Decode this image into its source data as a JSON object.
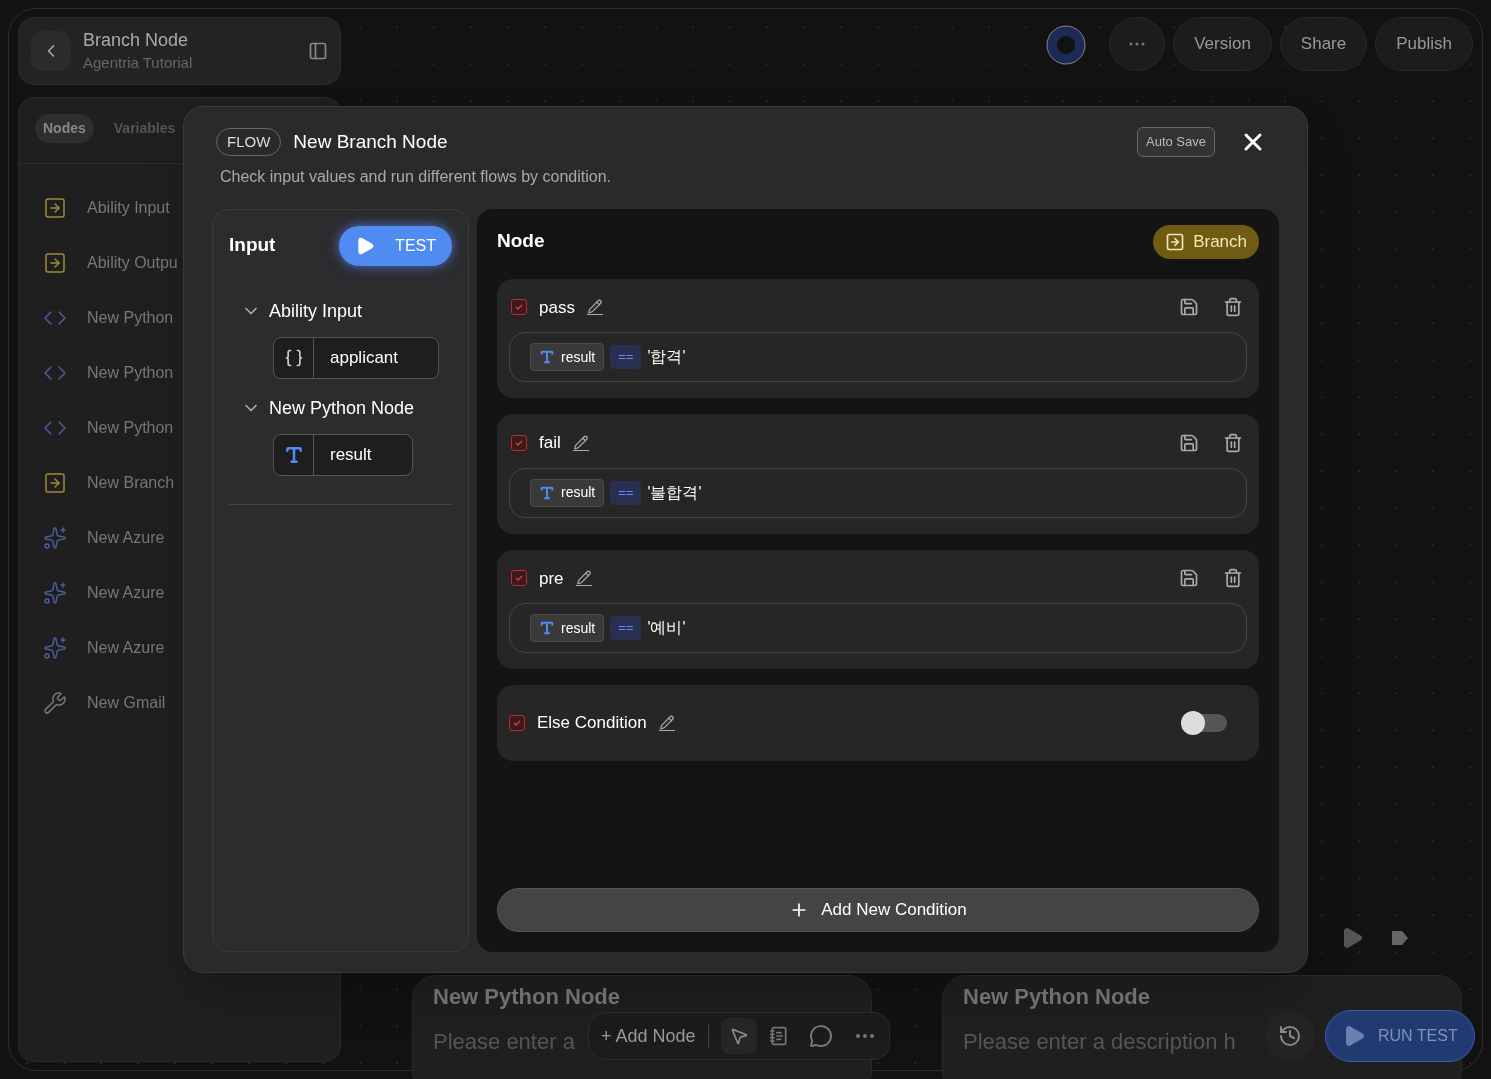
{
  "header": {
    "title": "Branch Node",
    "subtitle": "Agentria Tutorial"
  },
  "sidebar": {
    "tabs": [
      {
        "label": "Nodes",
        "selected": true
      },
      {
        "label": "Variables",
        "selected": false
      }
    ],
    "items": [
      {
        "label": "Ability Input",
        "kind": "io"
      },
      {
        "label": "Ability Outpu",
        "kind": "io"
      },
      {
        "label": "New Python",
        "kind": "code"
      },
      {
        "label": "New Python",
        "kind": "code"
      },
      {
        "label": "New Python",
        "kind": "code"
      },
      {
        "label": "New Branch",
        "kind": "io"
      },
      {
        "label": "New Azure",
        "kind": "ai"
      },
      {
        "label": "New Azure",
        "kind": "ai"
      },
      {
        "label": "New Azure",
        "kind": "ai"
      },
      {
        "label": "New Gmail",
        "kind": "tool"
      }
    ]
  },
  "top_actions": [
    "Version",
    "Share",
    "Publish"
  ],
  "canvas_nodes": [
    {
      "title": "New Python Node",
      "description": "Please enter a"
    },
    {
      "title": "New Python Node",
      "description": "Please enter a description h"
    }
  ],
  "toolbar": {
    "add_label": "+ Add Node"
  },
  "run_test": "RUN TEST",
  "modal": {
    "badge": "FLOW",
    "title": "New Branch Node",
    "description": "Check input values and run different flows by condition.",
    "auto_save": "Auto Save",
    "input": {
      "title": "Input",
      "test_label": "TEST",
      "groups": [
        {
          "name": "Ability Input",
          "expanded": true,
          "fields": [
            {
              "name": "applicant",
              "kind": "object"
            }
          ]
        },
        {
          "name": "New Python Node",
          "expanded": true,
          "fields": [
            {
              "name": "result",
              "kind": "text"
            }
          ]
        }
      ]
    },
    "node": {
      "title": "Node",
      "branch_label": "Branch",
      "conditions": [
        {
          "name": "pass",
          "checked": true,
          "variable": "result",
          "operator": "==",
          "value": "'합격'"
        },
        {
          "name": "fail",
          "checked": true,
          "variable": "result",
          "operator": "==",
          "value": "'불합격'"
        },
        {
          "name": "pre",
          "checked": true,
          "variable": "result",
          "operator": "==",
          "value": "'예비'"
        }
      ],
      "else": {
        "name": "Else Condition",
        "checked": true,
        "on": false
      },
      "add_label": "Add New Condition"
    }
  }
}
